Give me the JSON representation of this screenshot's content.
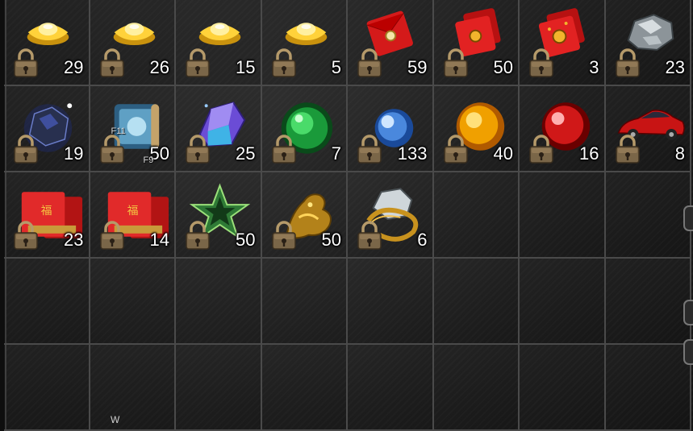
{
  "inventory": {
    "rows": 5,
    "cols": 8,
    "items": [
      {
        "name": "gold-ingot-icon",
        "count": "29",
        "locked": true
      },
      {
        "name": "gold-ingot-icon",
        "count": "26",
        "locked": true
      },
      {
        "name": "gold-ingot-icon",
        "count": "15",
        "locked": true
      },
      {
        "name": "gold-ingot-icon",
        "count": "5",
        "locked": true
      },
      {
        "name": "red-envelope-icon",
        "count": "59",
        "locked": true
      },
      {
        "name": "red-envelope-stack-icon",
        "count": "50",
        "locked": true
      },
      {
        "name": "red-envelope-stack-gold-icon",
        "count": "3",
        "locked": true
      },
      {
        "name": "silver-ore-icon",
        "count": "23",
        "locked": true
      },
      {
        "name": "dark-crystal-ore-icon",
        "count": "19",
        "locked": true
      },
      {
        "name": "scroll-icon",
        "count": "50",
        "locked": true,
        "hotkeys": [
          "F11",
          "F9"
        ]
      },
      {
        "name": "purple-gem-icon",
        "count": "25",
        "locked": true
      },
      {
        "name": "green-orb-icon",
        "count": "7",
        "locked": true
      },
      {
        "name": "blue-orb-icon",
        "count": "133",
        "locked": true
      },
      {
        "name": "orange-orb-icon",
        "count": "40",
        "locked": true
      },
      {
        "name": "red-orb-icon",
        "count": "16",
        "locked": true
      },
      {
        "name": "red-car-icon",
        "count": "8",
        "locked": true
      },
      {
        "name": "fortune-red-envelope-icon",
        "count": "23",
        "locked": true
      },
      {
        "name": "fortune-red-envelope-icon",
        "count": "14",
        "locked": true
      },
      {
        "name": "green-star-icon",
        "count": "50",
        "locked": true
      },
      {
        "name": "golden-dragon-icon",
        "count": "50",
        "locked": true
      },
      {
        "name": "ore-with-gold-ring-icon",
        "count": "6",
        "locked": true
      }
    ],
    "footer_label": "W"
  },
  "colors": {
    "grid_line": "#4a4a4a",
    "background": "#1b1b1b",
    "count_text": "#ffffff"
  }
}
